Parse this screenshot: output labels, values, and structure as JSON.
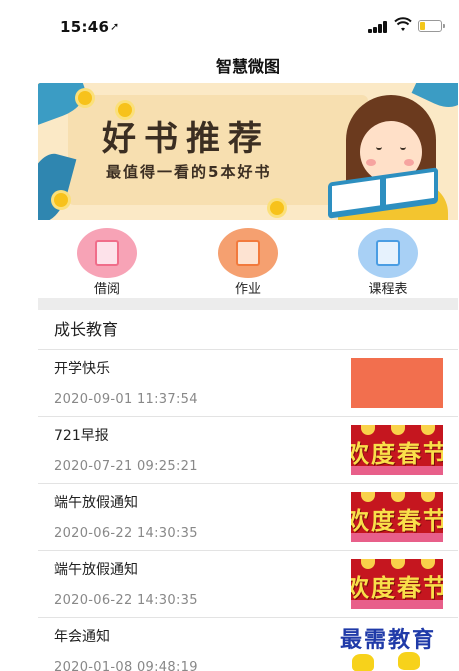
{
  "status_bar": {
    "time": "15:46",
    "location_icon": "location-arrow-icon",
    "signal_icon": "cellular-signal-icon",
    "wifi_icon": "wifi-icon",
    "battery_icon": "battery-low-icon",
    "battery_level_fraction": 0.2,
    "battery_color": "#f3c71b"
  },
  "nav": {
    "title": "智慧微图"
  },
  "banner": {
    "headline": "好书推荐",
    "subline": "最值得一看的5本好书"
  },
  "quick_actions": [
    {
      "label": "借阅",
      "icon": "book-borrow-icon",
      "color": "#f06d8a"
    },
    {
      "label": "作业",
      "icon": "homework-icon",
      "color": "#f27a3d"
    },
    {
      "label": "课程表",
      "icon": "calendar-icon",
      "color": "#4a9de3"
    }
  ],
  "section": {
    "title": "成长教育"
  },
  "articles": [
    {
      "title": "开学快乐",
      "time": "2020-09-01 11:37:54",
      "thumb": "plain"
    },
    {
      "title": "721早报",
      "time": "2020-07-21 09:25:21",
      "thumb": "festive",
      "thumb_text": "欢度春节"
    },
    {
      "title": "端午放假通知",
      "time": "2020-06-22 14:30:35",
      "thumb": "festive",
      "thumb_text": "欢度春节"
    },
    {
      "title": "端午放假通知",
      "time": "2020-06-22 14:30:35",
      "thumb": "festive",
      "thumb_text": "欢度春节"
    },
    {
      "title": "年会通知",
      "time": "2020-01-08 09:48:19",
      "thumb": "none"
    }
  ],
  "watermark": {
    "text": "最需教育"
  }
}
